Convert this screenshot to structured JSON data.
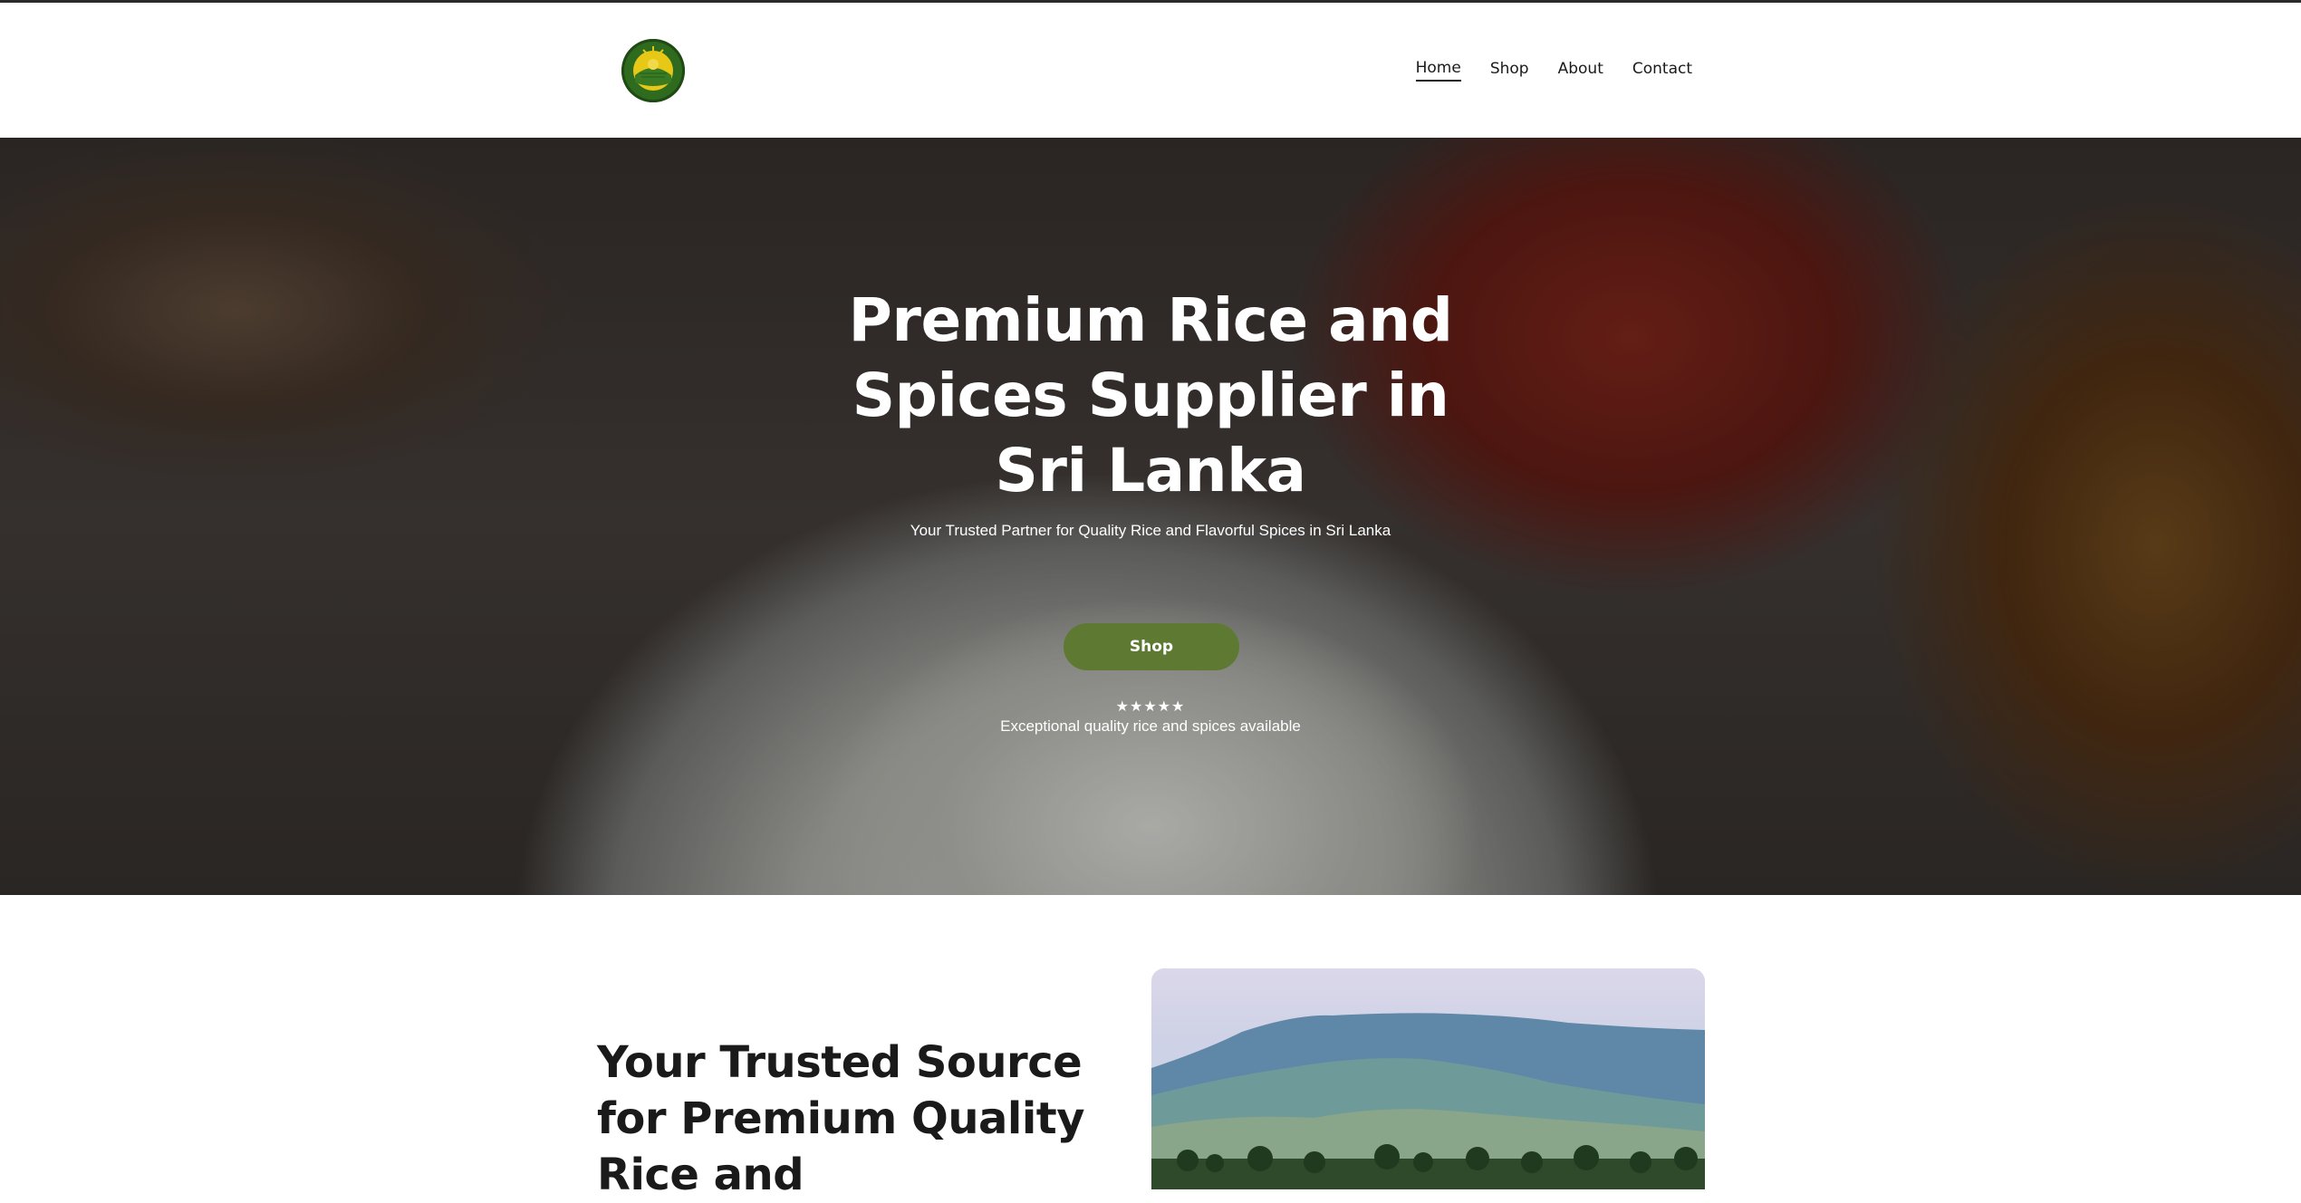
{
  "header": {
    "logo_alt": "K P Rice logo",
    "nav": [
      {
        "label": "Home",
        "active": true
      },
      {
        "label": "Shop",
        "active": false
      },
      {
        "label": "About",
        "active": false
      },
      {
        "label": "Contact",
        "active": false
      }
    ]
  },
  "hero": {
    "title": "Premium Rice and Spices Supplier in Sri Lanka",
    "subtitle": "Your Trusted Partner for Quality Rice and Flavorful Spices in Sri Lanka",
    "cta_label": "Shop",
    "stars": "★★★★★",
    "rating_text": "Exceptional quality rice and spices available"
  },
  "about": {
    "title": "Your Trusted Source for Premium Quality Rice and"
  },
  "colors": {
    "accent_green": "#5e7a32",
    "logo_green": "#2f6b1f",
    "logo_yellow": "#e8c817"
  }
}
